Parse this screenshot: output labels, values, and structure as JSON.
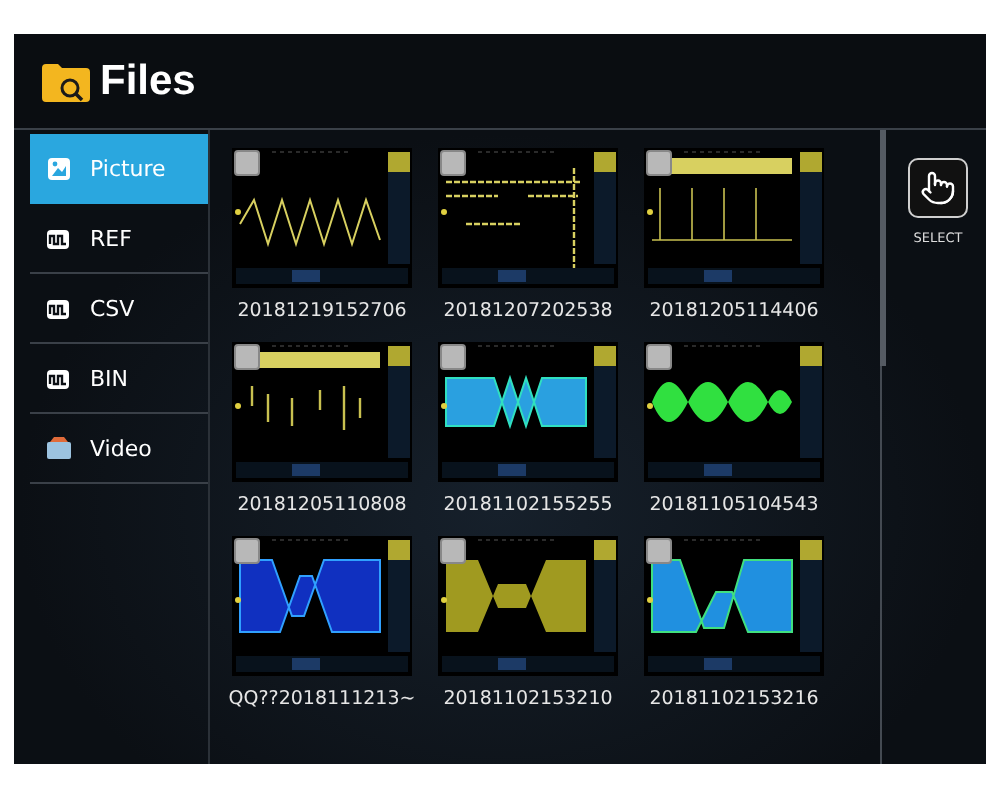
{
  "header": {
    "title": "Files"
  },
  "sidebar": {
    "items": [
      {
        "label": "Picture",
        "kind": "picture",
        "selected": true
      },
      {
        "label": "REF",
        "kind": "wave",
        "selected": false
      },
      {
        "label": "CSV",
        "kind": "wave",
        "selected": false
      },
      {
        "label": "BIN",
        "kind": "wave",
        "selected": false
      },
      {
        "label": "Video",
        "kind": "video",
        "selected": false
      }
    ]
  },
  "files": [
    {
      "name": "20181219152706",
      "checked": false
    },
    {
      "name": "20181207202538",
      "checked": false
    },
    {
      "name": "20181205114406",
      "checked": false
    },
    {
      "name": "20181205110808",
      "checked": false
    },
    {
      "name": "20181102155255",
      "checked": false
    },
    {
      "name": "20181105104543",
      "checked": false
    },
    {
      "name": "QQ??2018111213~",
      "checked": false
    },
    {
      "name": "20181102153210",
      "checked": false
    },
    {
      "name": "20181102153216",
      "checked": false
    }
  ],
  "actions": [
    {
      "label": "SELECT"
    }
  ]
}
